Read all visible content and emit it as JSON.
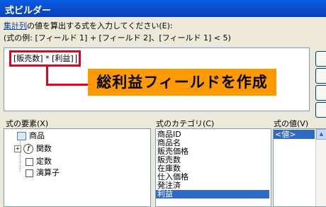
{
  "window": {
    "title": "式ビルダー"
  },
  "instruction": {
    "link_text": "集計列",
    "rest_text": "の値を算出する式を入力してください(E):"
  },
  "example": {
    "text": "(式の例: [フィールド 1] + [フィールド 2]、[フィールド 1] < 5)"
  },
  "expression": {
    "value": "[販売数] * [利益]"
  },
  "callout": {
    "text": "総利益フィールドを作成",
    "color": "#ff9900",
    "border_color": "#e8001f"
  },
  "elements_panel": {
    "label": "式の要素(X)",
    "items": [
      {
        "label": "商品",
        "icon": "table-icon"
      },
      {
        "label": "関数",
        "icon": "function-icon"
      },
      {
        "label": "定数",
        "icon": "constant-icon"
      },
      {
        "label": "演算子",
        "icon": "operator-icon"
      }
    ]
  },
  "categories_panel": {
    "label": "式のカテゴリ(C)",
    "items": [
      "商品ID",
      "商品名",
      "販売価格",
      "販売数",
      "在庫数",
      "仕入価格",
      "発注済",
      "利益"
    ],
    "selected": "利益"
  },
  "values_panel": {
    "label": "式の値(V)",
    "items": [
      "<値>"
    ],
    "selected": "<値>"
  }
}
